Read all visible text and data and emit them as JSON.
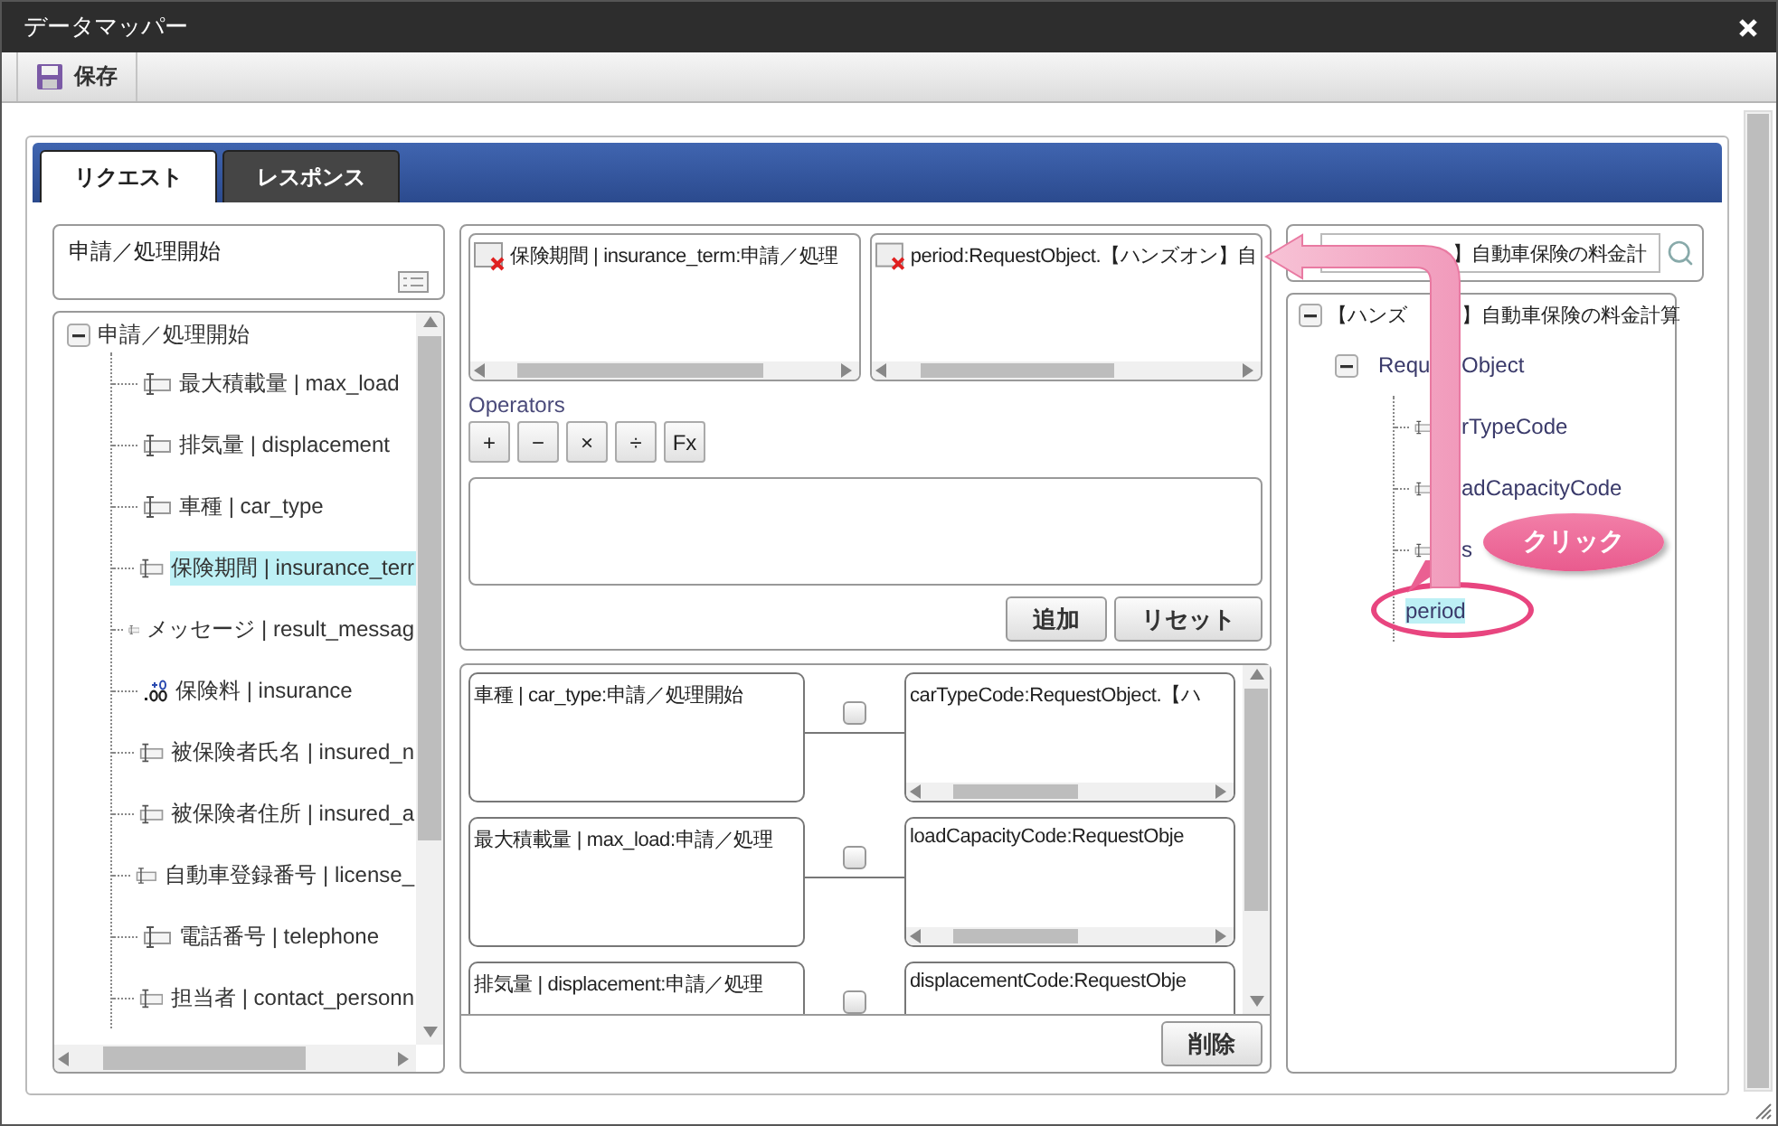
{
  "window": {
    "title": "データマッパー"
  },
  "toolbar": {
    "save": "保存"
  },
  "tabs": [
    {
      "label": "リクエスト",
      "selected": true
    },
    {
      "label": "レスポンス",
      "selected": false
    }
  ],
  "source": {
    "header": "申請／処理開始",
    "tree": {
      "label": "申請／処理開始",
      "expanded": true,
      "children": [
        {
          "label": "最大積載量 | max_load",
          "kind": "string",
          "selected": false
        },
        {
          "label": "排気量 | displacement",
          "kind": "string",
          "selected": false
        },
        {
          "label": "車種 | car_type",
          "kind": "string",
          "selected": false
        },
        {
          "label": "保険期間 | insurance_terr",
          "kind": "string",
          "selected": true
        },
        {
          "label": "メッセージ | result_messag",
          "kind": "string",
          "selected": false
        },
        {
          "label": "保険料 | insurance",
          "kind": "number",
          "selected": false
        },
        {
          "label": "被保険者氏名 | insured_n",
          "kind": "string",
          "selected": false
        },
        {
          "label": "被保険者住所 | insured_a",
          "kind": "string",
          "selected": false
        },
        {
          "label": "自動車登録番号 | license_",
          "kind": "string",
          "selected": false
        },
        {
          "label": "電話番号 | telephone",
          "kind": "string",
          "selected": false
        },
        {
          "label": "担当者 | contact_personn",
          "kind": "string",
          "selected": false
        }
      ]
    }
  },
  "editor": {
    "source_field": "保険期間 | insurance_term:申請／処理",
    "target_field": "period:RequestObject.【ハンズオン】自",
    "operators_label": "Operators",
    "operators": [
      "+",
      "−",
      "×",
      "÷",
      "Fx"
    ],
    "add": "追加",
    "reset": "リセット"
  },
  "mappings": [
    {
      "source": "車種 | car_type:申請／処理開始",
      "target": "carTypeCode:RequestObject.【ハ",
      "checked": false
    },
    {
      "source": "最大積載量 | max_load:申請／処理",
      "target": "loadCapacityCode:RequestObje",
      "checked": false
    },
    {
      "source": "排気量 | displacement:申請／処理",
      "target": "displacementCode:RequestObje",
      "checked": false
    }
  ],
  "delete": "削除",
  "target": {
    "search": "】自動車保険の料金計",
    "tree": {
      "label": "【ハンズ",
      "label_after": "】自動車保険の料金計算",
      "expanded": true,
      "children": [
        {
          "label": "Requ",
          "label_after": "Object",
          "expanded": true,
          "children": [
            {
              "label_after": "rTypeCode",
              "kind": "string",
              "selected": false
            },
            {
              "label_after": "adCapacityCode",
              "kind": "string",
              "selected": false
            },
            {
              "label_after": "s",
              "kind": "string",
              "selected": false
            },
            {
              "label": "period",
              "kind": "number",
              "selected": true
            }
          ]
        }
      ]
    }
  },
  "annotation": {
    "callout": "クリック"
  }
}
